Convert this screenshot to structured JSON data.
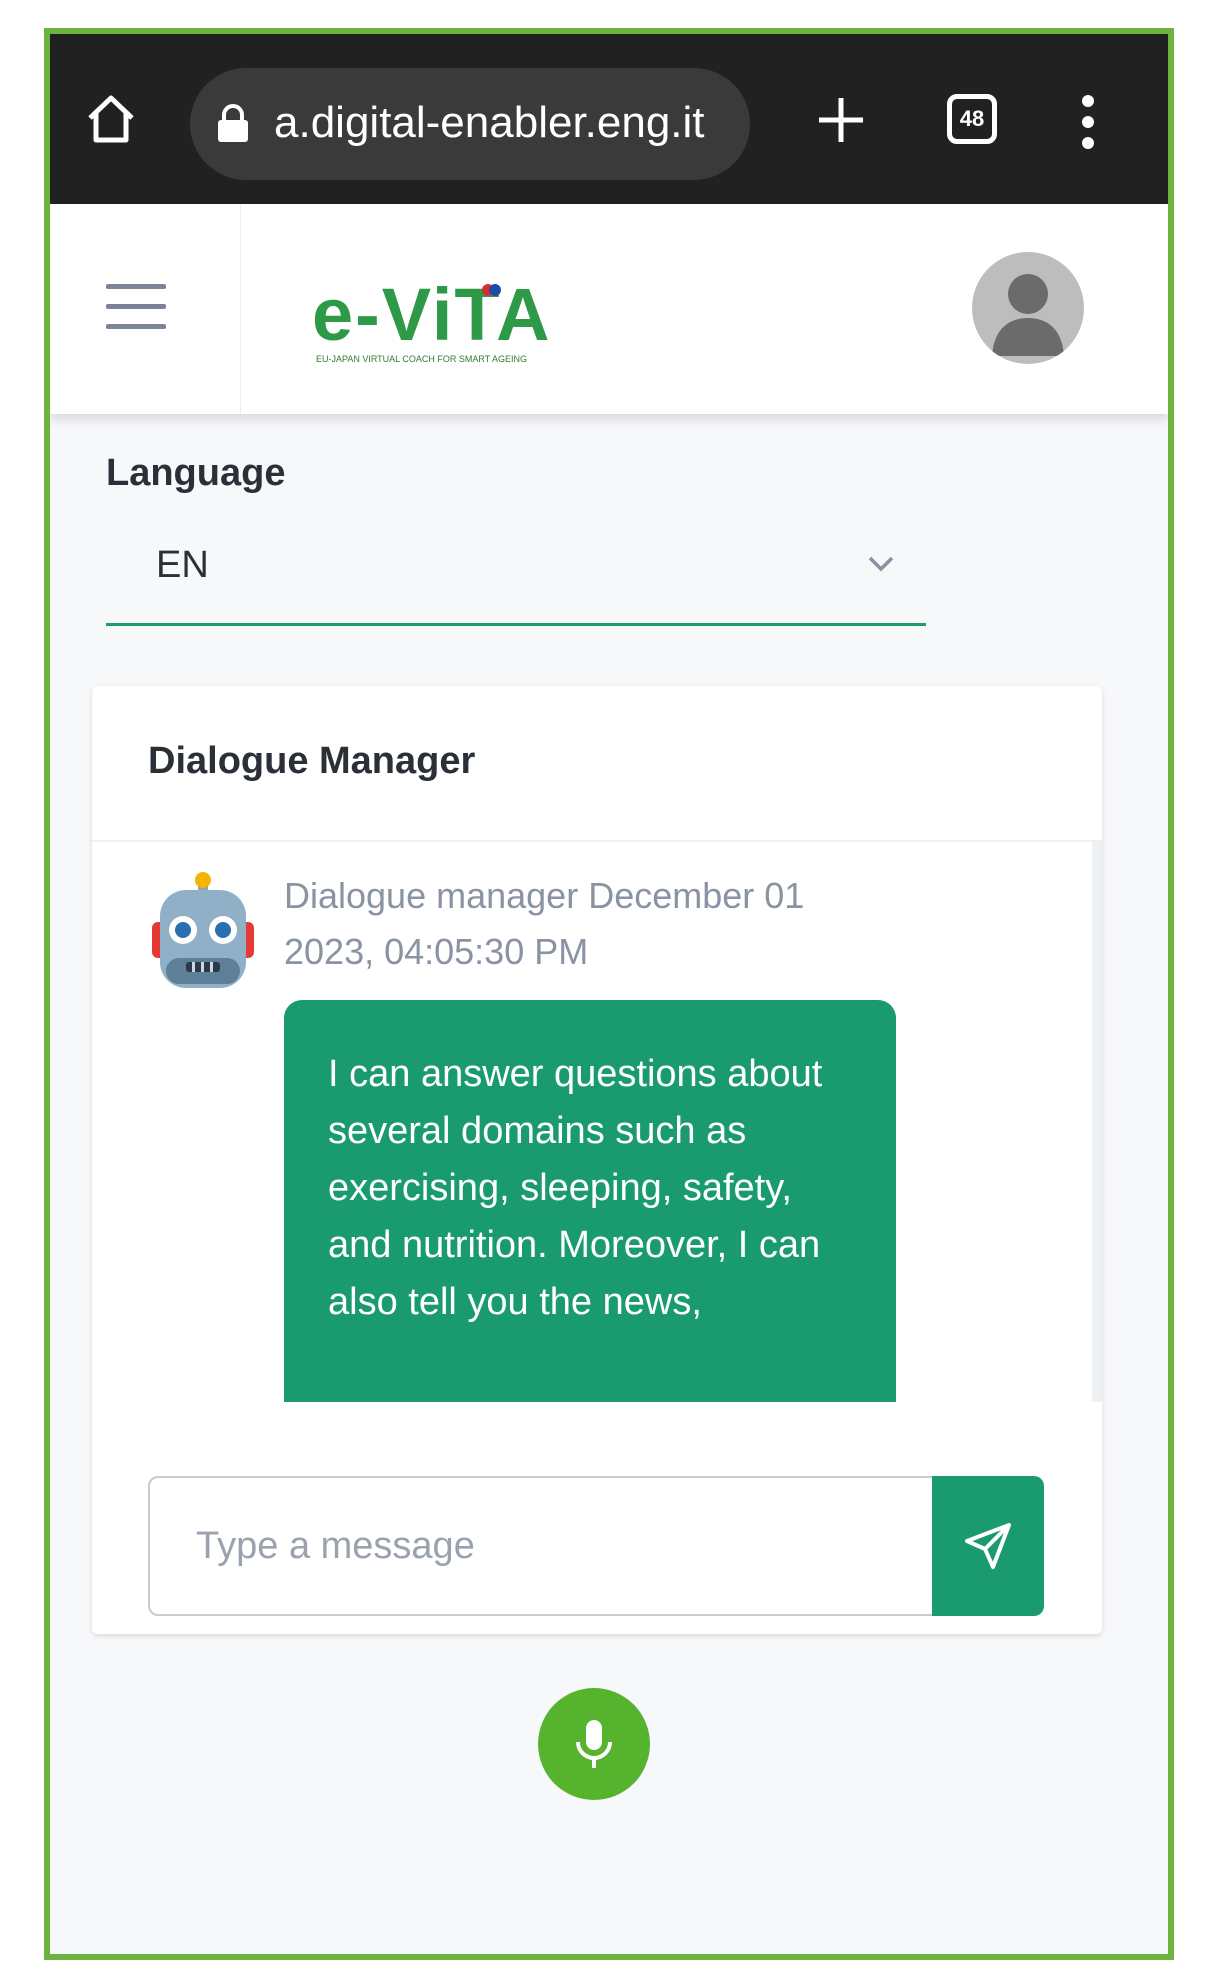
{
  "browser": {
    "url": "a.digital-enabler.eng.it",
    "tab_count": "48"
  },
  "header": {
    "logo_text": "e-ViTA",
    "logo_tagline": "EU-Japan Virtual coach for smart ageing"
  },
  "language": {
    "label": "Language",
    "selected": "EN"
  },
  "dialogue": {
    "title": "Dialogue Manager",
    "messages": [
      {
        "sender_meta": "Dialogue manager December 01 2023, 04:05:30 PM",
        "text": "I can answer questions about several domains such as exercising, sleeping, safety, and nutrition. Moreover, I can also tell you the news,"
      }
    ],
    "input_placeholder": "Type a message"
  },
  "colors": {
    "frame_border": "#6db33f",
    "accent_green": "#1a9b6f",
    "mic_green": "#56b32d",
    "browser_bar": "#212121"
  }
}
